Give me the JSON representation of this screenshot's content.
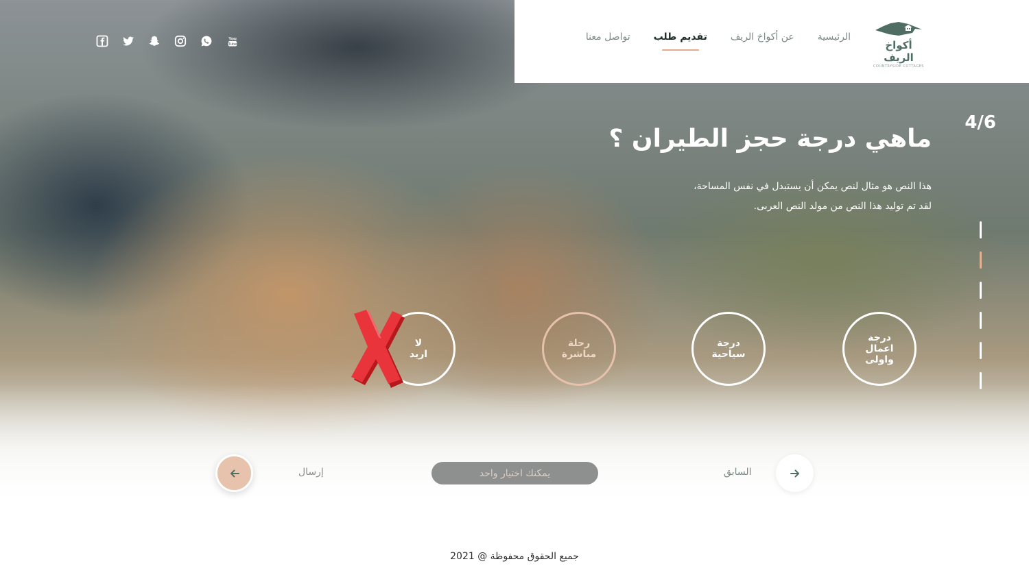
{
  "brand": {
    "name": "أكواخ الريف",
    "subtitle": "COUNTRYSIDE COTTAGES",
    "accent_color": "#4f6d62"
  },
  "nav": {
    "items": [
      {
        "label": "الرئيسية",
        "active": false
      },
      {
        "label": "عن أكواخ الريف",
        "active": false
      },
      {
        "label": "تقديم طلب",
        "active": true
      },
      {
        "label": "تواصل معنا",
        "active": false
      }
    ]
  },
  "social": {
    "icons": [
      "facebook-icon",
      "twitter-icon",
      "snapchat-icon",
      "instagram-icon",
      "whatsapp-icon",
      "youtube-icon"
    ]
  },
  "question": {
    "step": "4/6",
    "current_step": 4,
    "total_steps": 6,
    "title": "ماهي درجة حجز الطيران ؟",
    "description_line1": "هذا النص هو مثال لنص يمكن أن يستبدل في نفس المساحة،",
    "description_line2": "لقد تم توليد هذا النص من مولد النص العربى."
  },
  "options": [
    {
      "line1": "درجة",
      "line2": "اعمال واولى",
      "selected": false
    },
    {
      "line1": "درجة",
      "line2": "سياحية",
      "selected": false
    },
    {
      "line1": "رحلة",
      "line2": "مباشرة",
      "selected": true
    },
    {
      "line1": "لا",
      "line2": "اريد",
      "selected": false
    }
  ],
  "controls": {
    "prev_label": "السابق",
    "hint": "يمكنك اختيار واحد",
    "send_label": "إرسال",
    "accent_color": "#e7c3ad"
  },
  "footer": {
    "text": "جميع الحقوق محفوظة @ 2021"
  }
}
